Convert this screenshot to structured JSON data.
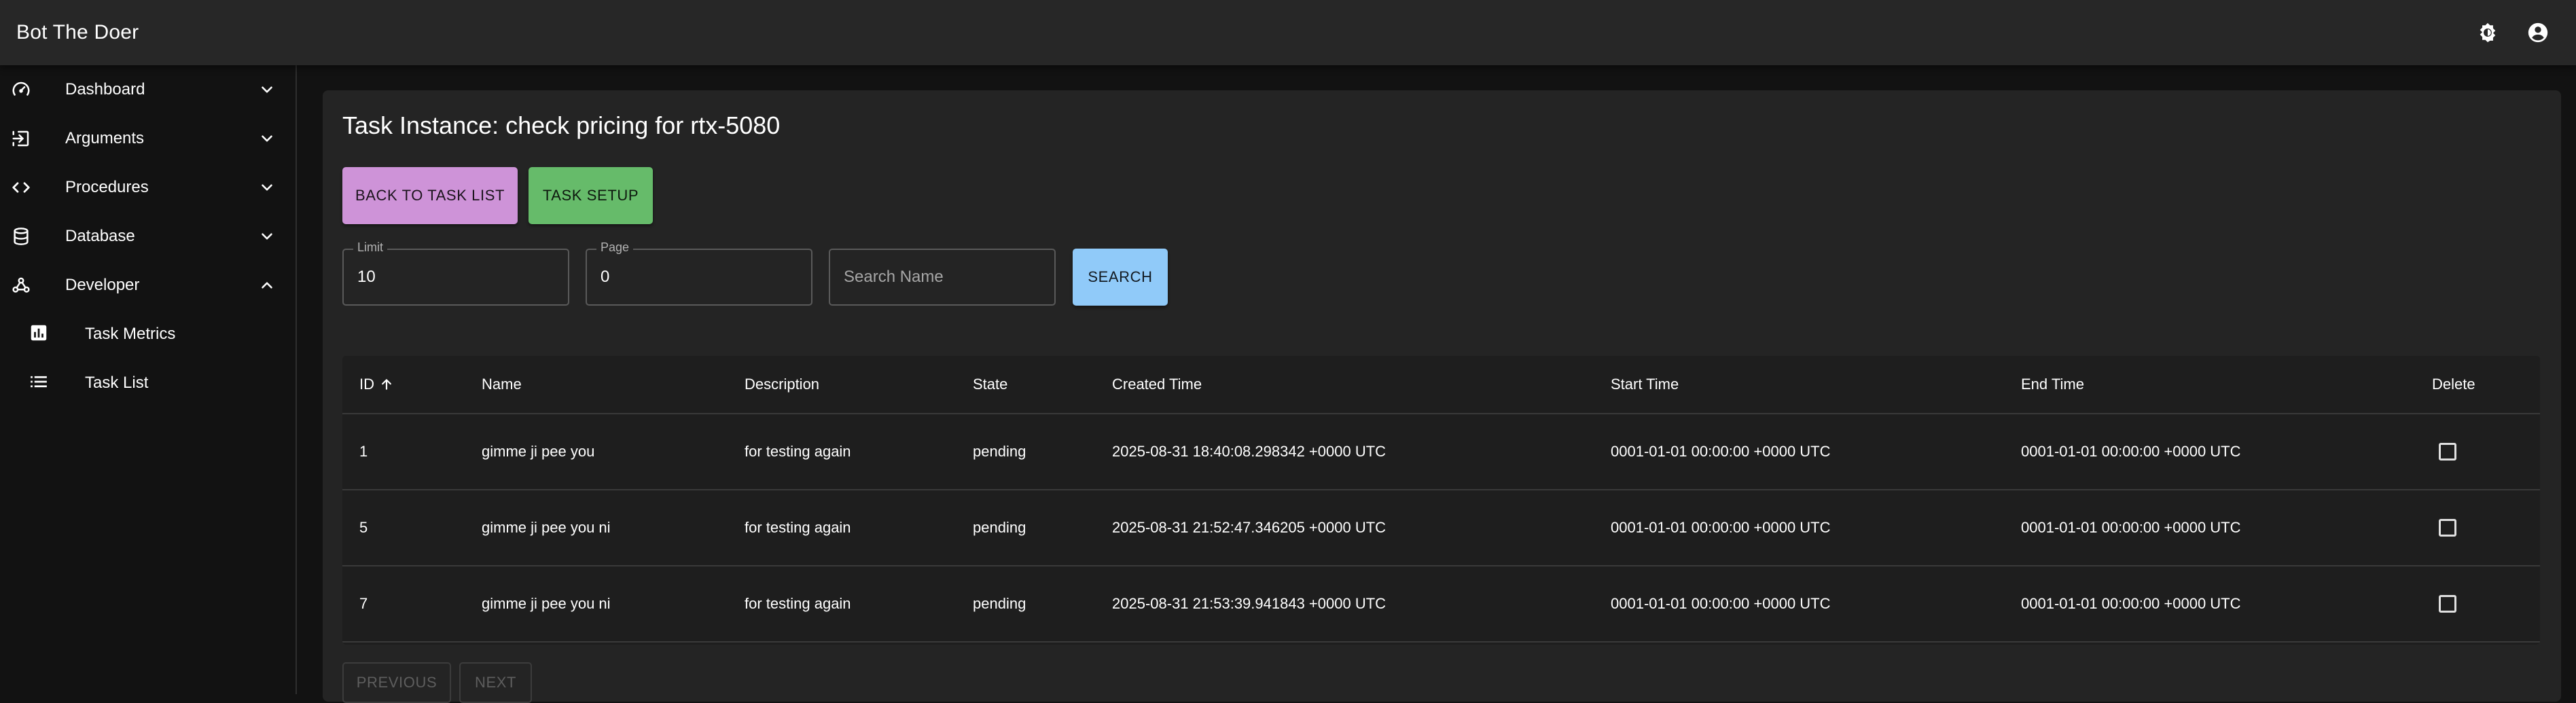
{
  "app": {
    "title": "Bot The Doer"
  },
  "appbar": {
    "icons": [
      "settings-brightness-icon",
      "account-circle-icon"
    ]
  },
  "sidebar": {
    "items": [
      {
        "label": "Dashboard",
        "icon": "speedometer-icon",
        "expanded": false
      },
      {
        "label": "Arguments",
        "icon": "input-icon",
        "expanded": false
      },
      {
        "label": "Procedures",
        "icon": "code-icon",
        "expanded": false
      },
      {
        "label": "Database",
        "icon": "database-icon",
        "expanded": false
      },
      {
        "label": "Developer",
        "icon": "webhook-icon",
        "expanded": true
      }
    ],
    "subitems": [
      {
        "label": "Task Metrics",
        "icon": "bar-chart-icon"
      },
      {
        "label": "Task List",
        "icon": "list-icon"
      }
    ]
  },
  "page": {
    "title": "Task Instance: check pricing for rtx-5080",
    "back_button": "BACK TO TASK LIST",
    "setup_button": "TASK SETUP",
    "search_button": "SEARCH"
  },
  "filters": {
    "limit_label": "Limit",
    "limit_value": "10",
    "page_label": "Page",
    "page_value": "0",
    "search_placeholder": "Search Name"
  },
  "table": {
    "columns": [
      "ID",
      "Name",
      "Description",
      "State",
      "Created Time",
      "Start Time",
      "End Time",
      "Delete"
    ],
    "sort": {
      "column": "ID",
      "direction": "ascending"
    },
    "rows": [
      {
        "id": "1",
        "name": "gimme ji pee you",
        "description": "for testing again",
        "state": "pending",
        "created": "2025-08-31 18:40:08.298342 +0000 UTC",
        "start": "0001-01-01 00:00:00 +0000 UTC",
        "end": "0001-01-01 00:00:00 +0000 UTC",
        "delete_checked": false
      },
      {
        "id": "5",
        "name": "gimme ji pee you ni",
        "description": "for testing again",
        "state": "pending",
        "created": "2025-08-31 21:52:47.346205 +0000 UTC",
        "start": "0001-01-01 00:00:00 +0000 UTC",
        "end": "0001-01-01 00:00:00 +0000 UTC",
        "delete_checked": false
      },
      {
        "id": "7",
        "name": "gimme ji pee you ni",
        "description": "for testing again",
        "state": "pending",
        "created": "2025-08-31 21:53:39.941843 +0000 UTC",
        "start": "0001-01-01 00:00:00 +0000 UTC",
        "end": "0001-01-01 00:00:00 +0000 UTC",
        "delete_checked": false
      }
    ]
  },
  "pagination": {
    "previous_label": "PREVIOUS",
    "next_label": "NEXT"
  },
  "colors": {
    "app_bar": "#272727",
    "background": "#121212",
    "panel": "#242424",
    "back_button": "#ce93d8",
    "setup_button": "#66bb6a",
    "search_button": "#90caf9"
  }
}
